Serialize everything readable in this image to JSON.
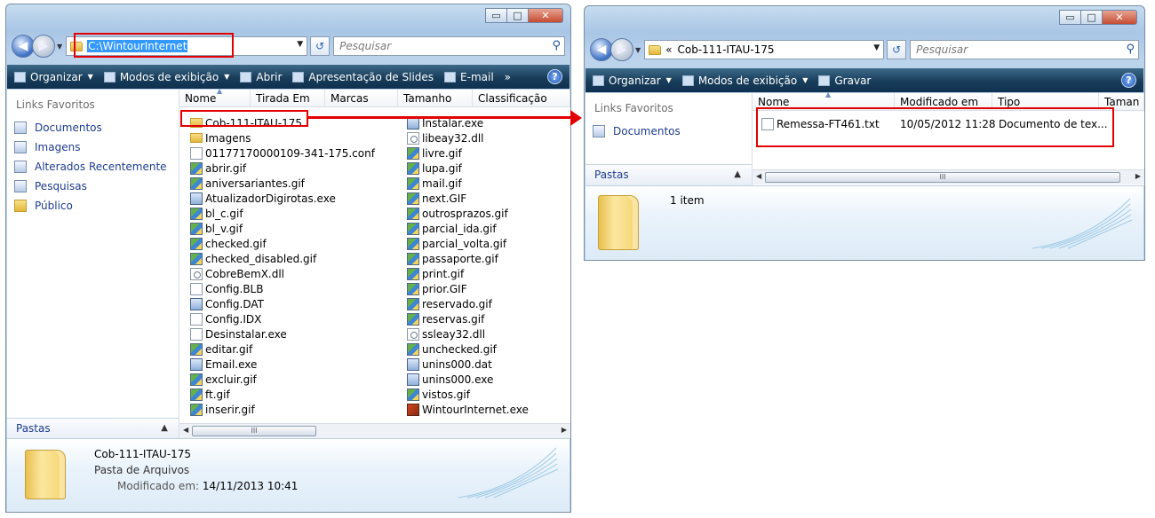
{
  "colors": {
    "highlight": "#e30000",
    "link": "#1e3d8f"
  },
  "left": {
    "address": "C:\\WintourInternet",
    "search_placeholder": "Pesquisar",
    "toolbar": [
      {
        "label": "Organizar",
        "dropdown": true
      },
      {
        "label": "Modos de exibição",
        "dropdown": true
      },
      {
        "label": "Abrir",
        "dropdown": false
      },
      {
        "label": "Apresentação de Slides",
        "dropdown": false
      },
      {
        "label": "E-mail",
        "dropdown": false
      }
    ],
    "toolbar_more": "»",
    "help": "?",
    "nav_header": "Links Favoritos",
    "nav_items": [
      "Documentos",
      "Imagens",
      "Alterados Recentemente",
      "Pesquisas",
      "Público"
    ],
    "pastas": "Pastas",
    "columns": [
      "Nome",
      "Tirada Em",
      "Marcas",
      "Tamanho",
      "Classificação"
    ],
    "files_col1": [
      {
        "name": "Cob-111-ITAU-175",
        "icon": "folder"
      },
      {
        "name": "Imagens",
        "icon": "folder"
      },
      {
        "name": "01177170000109-341-175.conf",
        "icon": "doc"
      },
      {
        "name": "abrir.gif",
        "icon": "gif"
      },
      {
        "name": "aniversariantes.gif",
        "icon": "gif"
      },
      {
        "name": "AtualizadorDigirotas.exe",
        "icon": "exe"
      },
      {
        "name": "bl_c.gif",
        "icon": "gif"
      },
      {
        "name": "bl_v.gif",
        "icon": "gif"
      },
      {
        "name": "checked.gif",
        "icon": "gif"
      },
      {
        "name": "checked_disabled.gif",
        "icon": "gif"
      },
      {
        "name": "CobreBemX.dll",
        "icon": "dll"
      },
      {
        "name": "Config.BLB",
        "icon": "doc"
      },
      {
        "name": "Config.DAT",
        "icon": "exe"
      },
      {
        "name": "Config.IDX",
        "icon": "doc"
      },
      {
        "name": "Desinstalar.exe",
        "icon": "doc"
      },
      {
        "name": "editar.gif",
        "icon": "gif"
      },
      {
        "name": "Email.exe",
        "icon": "exe"
      },
      {
        "name": "excluir.gif",
        "icon": "gif"
      },
      {
        "name": "ft.gif",
        "icon": "gif"
      },
      {
        "name": "inserir.gif",
        "icon": "gif"
      }
    ],
    "files_col2": [
      {
        "name": "Instalar.exe",
        "icon": "exe"
      },
      {
        "name": "libeay32.dll",
        "icon": "dll"
      },
      {
        "name": "livre.gif",
        "icon": "gif"
      },
      {
        "name": "lupa.gif",
        "icon": "gif"
      },
      {
        "name": "mail.gif",
        "icon": "gif"
      },
      {
        "name": "next.GIF",
        "icon": "gif"
      },
      {
        "name": "outrosprazos.gif",
        "icon": "gif"
      },
      {
        "name": "parcial_ida.gif",
        "icon": "gif"
      },
      {
        "name": "parcial_volta.gif",
        "icon": "gif"
      },
      {
        "name": "passaporte.gif",
        "icon": "gif"
      },
      {
        "name": "print.gif",
        "icon": "gif"
      },
      {
        "name": "prior.GIF",
        "icon": "gif"
      },
      {
        "name": "reservado.gif",
        "icon": "gif"
      },
      {
        "name": "reservas.gif",
        "icon": "gif"
      },
      {
        "name": "ssleay32.dll",
        "icon": "dll"
      },
      {
        "name": "unchecked.gif",
        "icon": "gif"
      },
      {
        "name": "unins000.dat",
        "icon": "exe"
      },
      {
        "name": "unins000.exe",
        "icon": "exe"
      },
      {
        "name": "vistos.gif",
        "icon": "gif"
      },
      {
        "name": "WintourInternet.exe",
        "icon": "bigexe"
      }
    ],
    "details": {
      "name": "Cob-111-ITAU-175",
      "type": "Pasta de Arquivos",
      "modified_label": "Modificado em:",
      "modified_value": "14/11/2013 10:41"
    }
  },
  "right": {
    "breadcrumb_prefix": "«",
    "address": "Cob-111-ITAU-175",
    "search_placeholder": "Pesquisar",
    "toolbar": [
      {
        "label": "Organizar",
        "dropdown": true
      },
      {
        "label": "Modos de exibição",
        "dropdown": true
      },
      {
        "label": "Gravar",
        "dropdown": false
      }
    ],
    "help": "?",
    "nav_header": "Links Favoritos",
    "nav_items": [
      "Documentos"
    ],
    "pastas": "Pastas",
    "columns": [
      "Nome",
      "Modificado em",
      "Tipo",
      "Taman"
    ],
    "file": {
      "name": "Remessa-FT461.txt",
      "modified": "10/05/2012 11:28",
      "type": "Documento de tex..."
    },
    "details": {
      "count": "1 item"
    }
  },
  "scroll_thumb_glyph": "III"
}
